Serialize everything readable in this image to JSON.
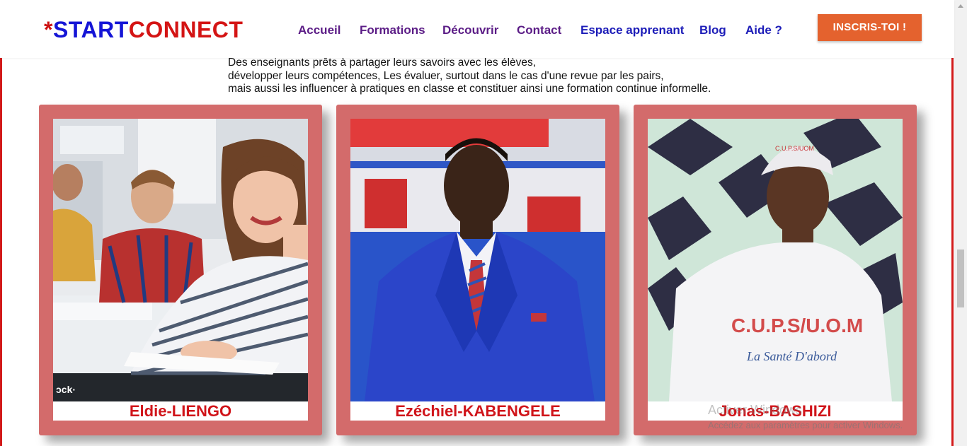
{
  "header": {
    "logo": {
      "star": "*",
      "start": "START",
      "connect": "CONNECT"
    },
    "nav": [
      {
        "label": "Accueil",
        "color": "purple"
      },
      {
        "label": "Formations",
        "color": "purple"
      },
      {
        "label": "Découvrir",
        "color": "purple"
      },
      {
        "label": "Contact",
        "color": "purple"
      },
      {
        "label": "Espace apprenant",
        "color": "blue"
      },
      {
        "label": "Blog",
        "color": "blue"
      },
      {
        "label": "Aide ?",
        "color": "blue"
      }
    ],
    "cta_label": "INSCRIS-TOI !"
  },
  "intro": {
    "lines": [
      "Des enseignants prêts à partager leurs savoirs avec les élèves,",
      "développer leurs compétences, Les évaluer, surtout dans le cas d'une revue par les pairs,",
      "mais aussi les influencer à pratiques en classe et constituer ainsi une formation continue informelle."
    ]
  },
  "cards": [
    {
      "name": "Eldie-LIENGO",
      "photo_footer": "ɔck·"
    },
    {
      "name": "Ezéchiel-KABENGELE"
    },
    {
      "name": "Jonas-BASHIZI",
      "shirt_line1": "C.U.P.S/U.O.M",
      "shirt_line2": "La Santé D'abord",
      "cap_text": "C.U.P.S/UOM"
    }
  ],
  "windows_activation": {
    "title": "Activer Windows",
    "subtitle": "Accédez aux paramètres pour activer Windows."
  },
  "colors": {
    "accent_red": "#d21a1a",
    "card_bg": "#d36b6b",
    "cta_orange": "#e4622e",
    "nav_purple": "#5b1c86",
    "nav_blue": "#1c1cb8"
  }
}
